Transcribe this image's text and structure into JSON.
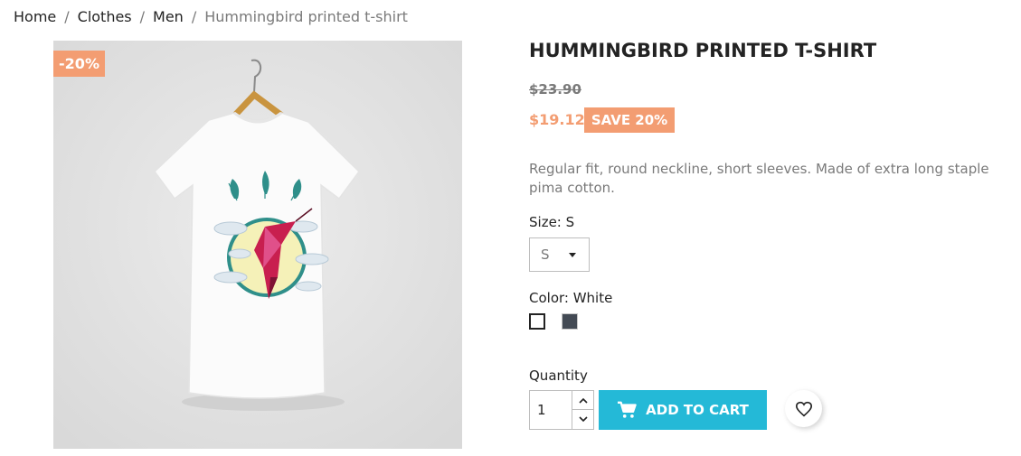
{
  "breadcrumb": {
    "items": [
      "Home",
      "Clothes",
      "Men"
    ],
    "current": "Hummingbird printed t-shirt",
    "separator": "/"
  },
  "product": {
    "discount_flag": "-20%",
    "title": "HUMMINGBIRD PRINTED T-SHIRT",
    "regular_price": "$23.90",
    "current_price": "$19.12",
    "save_badge": "SAVE 20%",
    "description": "Regular fit, round neckline, short sleeves. Made of extra long staple pima cotton."
  },
  "variants": {
    "size_label": "Size: S",
    "size_selected": "S",
    "color_label": "Color: White",
    "colors": [
      {
        "name": "White",
        "hex": "#ffffff",
        "selected": true
      },
      {
        "name": "Grey",
        "hex": "#434a54",
        "selected": false
      }
    ]
  },
  "purchase": {
    "quantity_label": "Quantity",
    "quantity_value": "1",
    "add_to_cart_label": "ADD TO CART",
    "cart_icon": "cart-icon",
    "wishlist_icon": "heart-icon"
  },
  "colors": {
    "accent": "#24b9d7",
    "discount": "#f39d72",
    "text": "#232323",
    "muted": "#7a7a7a"
  }
}
